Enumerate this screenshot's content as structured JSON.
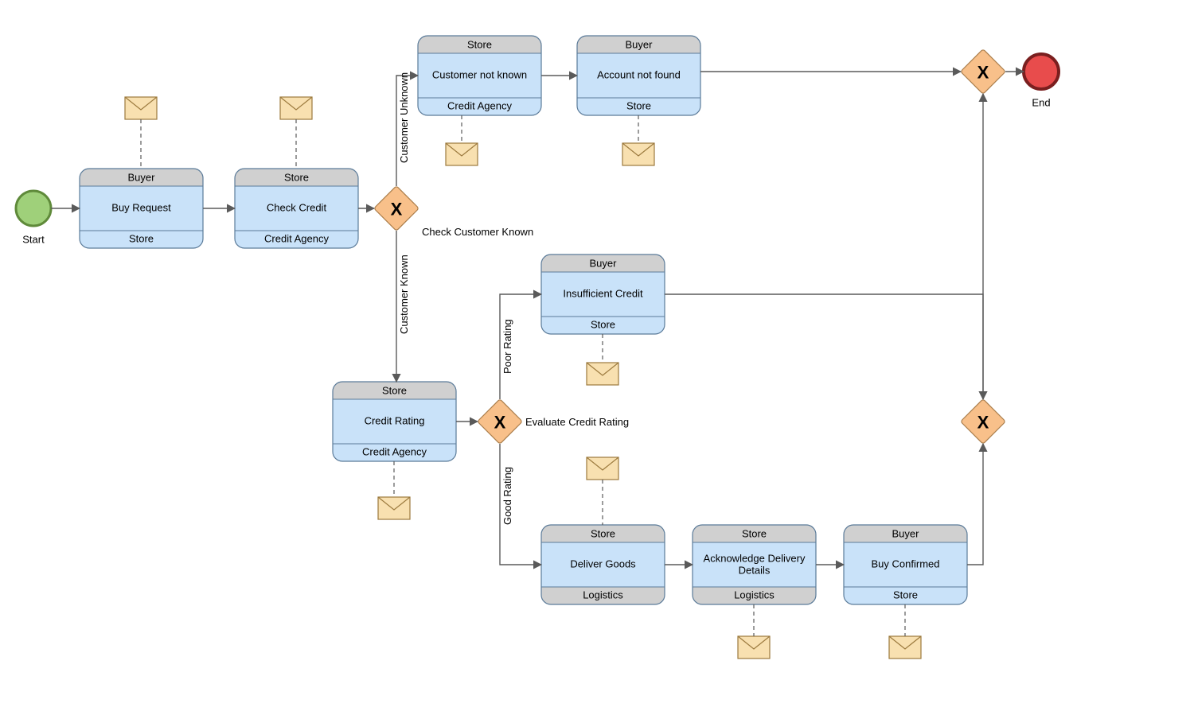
{
  "start": {
    "label": "Start"
  },
  "end": {
    "label": "End"
  },
  "gateways": {
    "g1": {
      "label": "Check Customer Known"
    },
    "g2": {
      "label": "Evaluate Credit Rating"
    }
  },
  "flows": {
    "cust_unknown": "Customer Unknown",
    "cust_known": "Customer Known",
    "poor_rating": "Poor Rating",
    "good_rating": "Good Rating"
  },
  "tasks": {
    "buy_request": {
      "top": "Buyer",
      "name": "Buy Request",
      "bottom": "Store"
    },
    "check_credit": {
      "top": "Store",
      "name": "Check Credit",
      "bottom": "Credit Agency"
    },
    "cust_not_known": {
      "top": "Store",
      "name": "Customer not known",
      "bottom": "Credit Agency"
    },
    "acct_not_found": {
      "top": "Buyer",
      "name": "Account not found",
      "bottom": "Store"
    },
    "credit_rating": {
      "top": "Store",
      "name": "Credit Rating",
      "bottom": "Credit Agency"
    },
    "insufficient_credit": {
      "top": "Buyer",
      "name": "Insufficient Credit",
      "bottom": "Store"
    },
    "deliver_goods": {
      "top": "Store",
      "name": "Deliver Goods",
      "bottom": "Logistics"
    },
    "ack_delivery": {
      "top": "Store",
      "name_l1": "Acknowledge Delivery",
      "name_l2": "Details",
      "bottom": "Logistics"
    },
    "buy_confirmed": {
      "top": "Buyer",
      "name": "Buy Confirmed",
      "bottom": "Store"
    }
  }
}
